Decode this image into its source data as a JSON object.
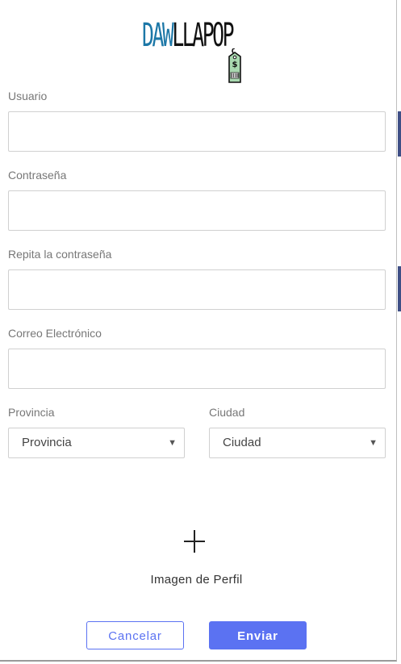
{
  "logo": {
    "text_part1": "DAW",
    "text_part2": "LLAPOP",
    "tag_symbol": "$"
  },
  "form": {
    "username_label": "Usuario",
    "username_value": "",
    "password_label": "Contraseña",
    "password_value": "",
    "repeat_password_label": "Repita la contraseña",
    "repeat_password_value": "",
    "email_label": "Correo Electrónico",
    "email_value": "",
    "province_label": "Provincia",
    "province_selected": "Provincia",
    "city_label": "Ciudad",
    "city_selected": "Ciudad",
    "profile_image_label": "Imagen de Perfil"
  },
  "buttons": {
    "cancel_label": "Cancelar",
    "submit_label": "Enviar"
  },
  "colors": {
    "accent": "#5b72f2",
    "logo_blue": "#1c77a7",
    "label_gray": "#777777"
  },
  "icons": [
    "price-tag-icon",
    "plus-icon",
    "dropdown-arrow-icon"
  ]
}
